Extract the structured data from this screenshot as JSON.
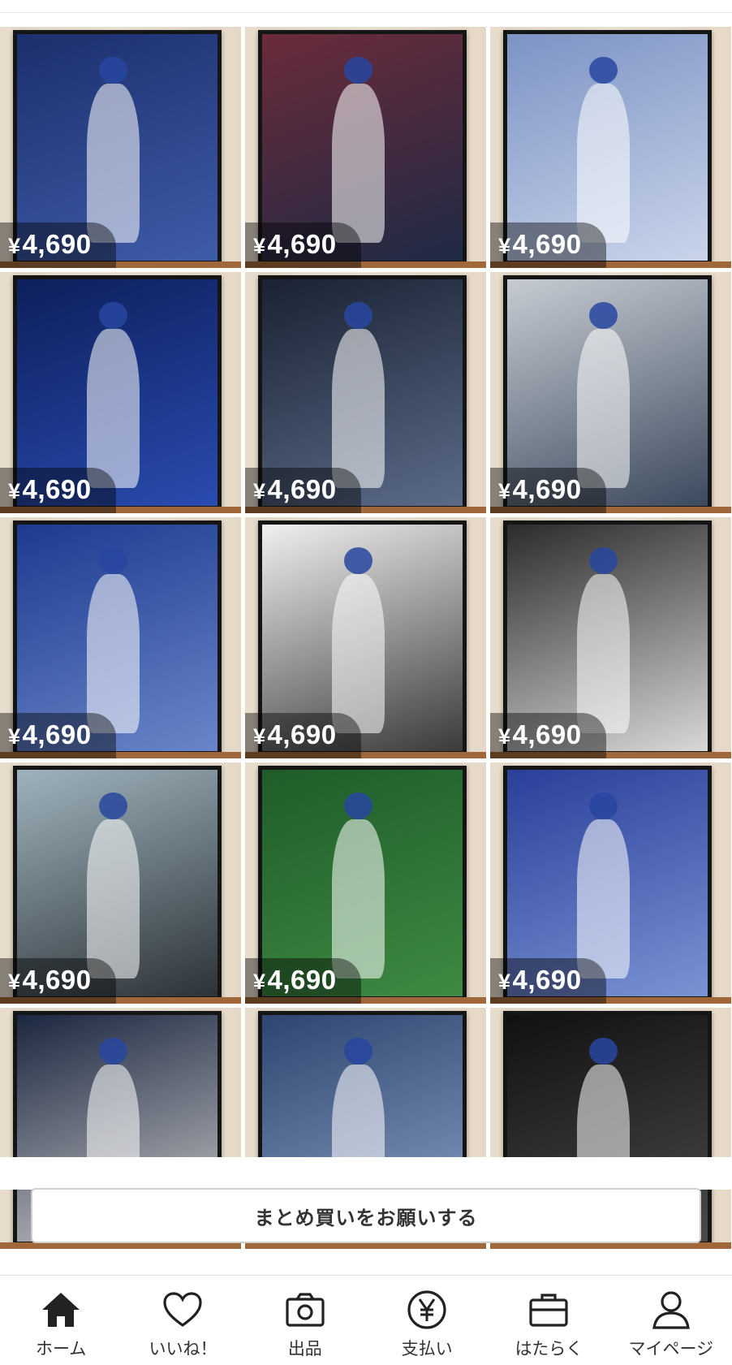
{
  "listing": {
    "items": [
      {
        "price_symbol": "¥",
        "price": "4,690",
        "poster_colors": [
          "#1c2f6e",
          "#3f5ca8"
        ]
      },
      {
        "price_symbol": "¥",
        "price": "4,690",
        "poster_colors": [
          "#6b2b3a",
          "#1f2a45"
        ]
      },
      {
        "price_symbol": "¥",
        "price": "4,690",
        "poster_colors": [
          "#7c93c4",
          "#c9d4ea"
        ]
      },
      {
        "price_symbol": "¥",
        "price": "4,690",
        "poster_colors": [
          "#0d1f5c",
          "#2a4cb0"
        ]
      },
      {
        "price_symbol": "¥",
        "price": "4,690",
        "poster_colors": [
          "#1a2233",
          "#5b6b88"
        ]
      },
      {
        "price_symbol": "¥",
        "price": "4,690",
        "poster_colors": [
          "#c7ccd3",
          "#3c4a5e"
        ]
      },
      {
        "price_symbol": "¥",
        "price": "4,690",
        "poster_colors": [
          "#1d3a8f",
          "#6a86c9"
        ]
      },
      {
        "price_symbol": "¥",
        "price": "4,690",
        "poster_colors": [
          "#f0f0f0",
          "#3a3a3a"
        ]
      },
      {
        "price_symbol": "¥",
        "price": "4,690",
        "poster_colors": [
          "#2b2b2b",
          "#d8d8d8"
        ]
      },
      {
        "price_symbol": "¥",
        "price": "4,690",
        "poster_colors": [
          "#9fb3bd",
          "#2c3338"
        ]
      },
      {
        "price_symbol": "¥",
        "price": "4,690",
        "poster_colors": [
          "#1f5c2a",
          "#3f8a42"
        ]
      },
      {
        "price_symbol": "¥",
        "price": "4,690",
        "poster_colors": [
          "#2a3f99",
          "#7a93d4"
        ]
      },
      {
        "price_symbol": "",
        "price": "",
        "poster_colors": [
          "#1b2740",
          "#c9c9c9"
        ]
      },
      {
        "price_symbol": "",
        "price": "",
        "poster_colors": [
          "#2e4570",
          "#8aa0c4"
        ]
      },
      {
        "price_symbol": "",
        "price": "",
        "poster_colors": [
          "#111111",
          "#4a4a4a"
        ]
      }
    ]
  },
  "bulk_button": {
    "label": "まとめ買いをお願いする"
  },
  "bottom_nav": {
    "items": [
      {
        "label": "ホーム",
        "icon": "home-icon"
      },
      {
        "label": "いいね！",
        "icon": "heart-icon"
      },
      {
        "label": "出品",
        "icon": "camera-icon"
      },
      {
        "label": "支払い",
        "icon": "yen-icon"
      },
      {
        "label": "はたらく",
        "icon": "briefcase-icon"
      },
      {
        "label": "マイページ",
        "icon": "person-icon"
      }
    ]
  }
}
